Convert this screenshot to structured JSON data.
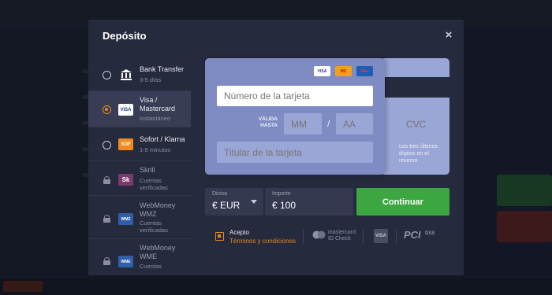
{
  "modal": {
    "title": "Depósito",
    "close_icon": "×"
  },
  "methods": [
    {
      "name": "Bank Transfer",
      "sub": "3-5 días",
      "icon": "bank-icon",
      "state": "radio"
    },
    {
      "name": "Visa / Mastercard",
      "sub": "Instantáneo",
      "icon": "visa-mastercard-icon",
      "state": "selected"
    },
    {
      "name": "Sofort / Klarna",
      "sub": "1-5 minutos",
      "icon": "sofort-icon",
      "state": "radio"
    },
    {
      "name": "Skrill",
      "sub": "Cuentas verificadas",
      "icon": "skrill-icon",
      "state": "locked"
    },
    {
      "name": "WebMoney WMZ",
      "sub": "Cuentas verificadas",
      "icon": "webmoney-icon",
      "state": "locked"
    },
    {
      "name": "WebMoney WME",
      "sub": "Cuentas",
      "icon": "webmoney-icon",
      "state": "locked"
    }
  ],
  "method_labels": {
    "m1": "Bank Transfer",
    "m1_sub": "3-5 días",
    "m2_line1": "Visa /",
    "m2_line2": "Mastercard",
    "m2_sub": "Instantáneo",
    "m3": "Sofort / Klarna",
    "m3_sub": "1-5 minutos",
    "m4": "Skrill",
    "m4_sub1": "Cuentas",
    "m4_sub2": "verificadas",
    "m5_line1": "WebMoney",
    "m5_line2": "WMZ",
    "m5_sub1": "Cuentas",
    "m5_sub2": "verificadas",
    "m6_line1": "WebMoney",
    "m6_line2": "WME",
    "m6_sub1": "Cuentas"
  },
  "icon_text": {
    "visa": "VISA",
    "sofort": "SOF",
    "skrill": "Sk",
    "wmz": "WMZ",
    "wme": "WME",
    "mastercard": "MC",
    "maestro": "Mae"
  },
  "card": {
    "number_placeholder": "Número de la tarjeta",
    "valid_line1": "VÁLIDA",
    "valid_line2": "HASTA",
    "month_placeholder": "MM",
    "year_placeholder": "AA",
    "slash": "/",
    "holder_placeholder": "Titular de la tarjeta",
    "cvc_placeholder": "CVC",
    "cvc_help": "Los tres últimos dígitos en el reverso"
  },
  "currency": {
    "label": "Divisa",
    "value": "€ EUR"
  },
  "amount": {
    "label": "Importe",
    "value": "€ 100"
  },
  "continue_label": "Continuar",
  "accept": {
    "label": "Acepto",
    "link": "Términos y condiciones"
  },
  "badges": {
    "mc_line1": "mastercard",
    "mc_line2": "ID Check",
    "visa": "VISA",
    "pci": "PCI",
    "dss": "DSS"
  },
  "colors": {
    "accent_orange": "#e08a1e",
    "continue_green": "#3ca640",
    "modal_bg": "#262a3d",
    "card_blue": "#7f8cc3"
  }
}
